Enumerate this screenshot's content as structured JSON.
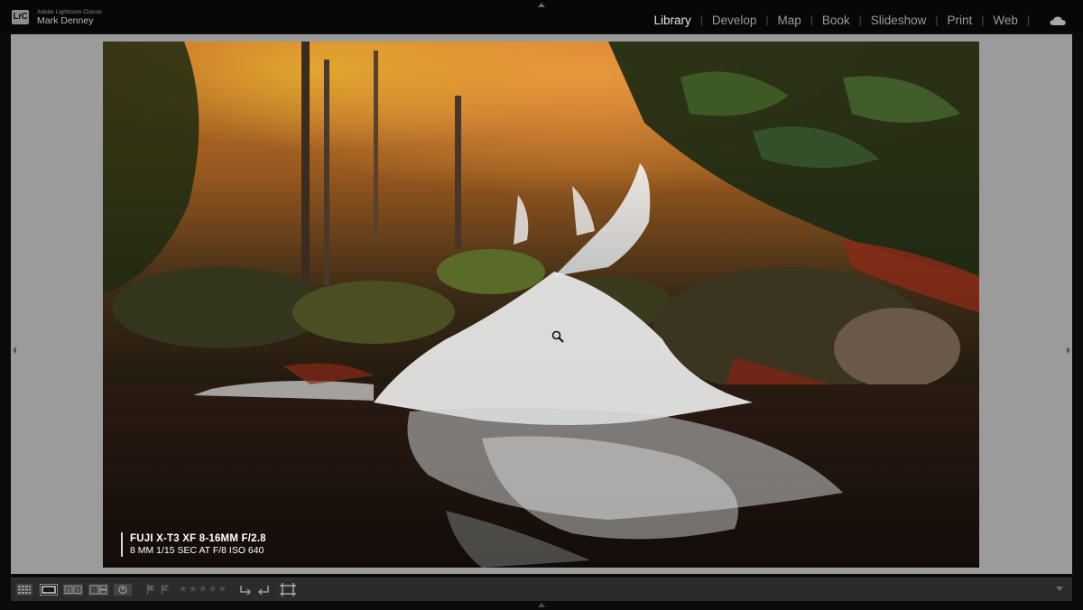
{
  "identity": {
    "badge": "LrC",
    "app_name": "Adobe Lightroom Classic",
    "user_name": "Mark Denney"
  },
  "modules": [
    {
      "label": "Library",
      "active": true
    },
    {
      "label": "Develop",
      "active": false
    },
    {
      "label": "Map",
      "active": false
    },
    {
      "label": "Book",
      "active": false
    },
    {
      "label": "Slideshow",
      "active": false
    },
    {
      "label": "Print",
      "active": false
    },
    {
      "label": "Web",
      "active": false
    }
  ],
  "module_separator": "|",
  "photo": {
    "subject": "autumn waterfall cascading over mossy rocks",
    "caption_line1": "FUJI X-T3 XF 8-16MM F/2.8",
    "caption_line2": "8 MM 1/15 SEC AT F/8 ISO 640"
  },
  "toolbar": {
    "icons": [
      "grid-view-icon",
      "loupe-view-icon",
      "compare-view-icon",
      "survey-view-icon",
      "people-view-icon",
      "flag-pick-icon",
      "flag-reject-icon",
      "rating-stars-icon",
      "rotate-left-icon",
      "rotate-right-icon",
      "crop-overlay-icon",
      "toolbar-menu-icon"
    ],
    "rating_stars": "★★★★★"
  },
  "colors": {
    "background": "#9b9b9b",
    "topbar": "#070707",
    "active_module": "#e6e6e6",
    "inactive_module": "#9a9a9a",
    "toolbar": "#2b2b2b"
  }
}
